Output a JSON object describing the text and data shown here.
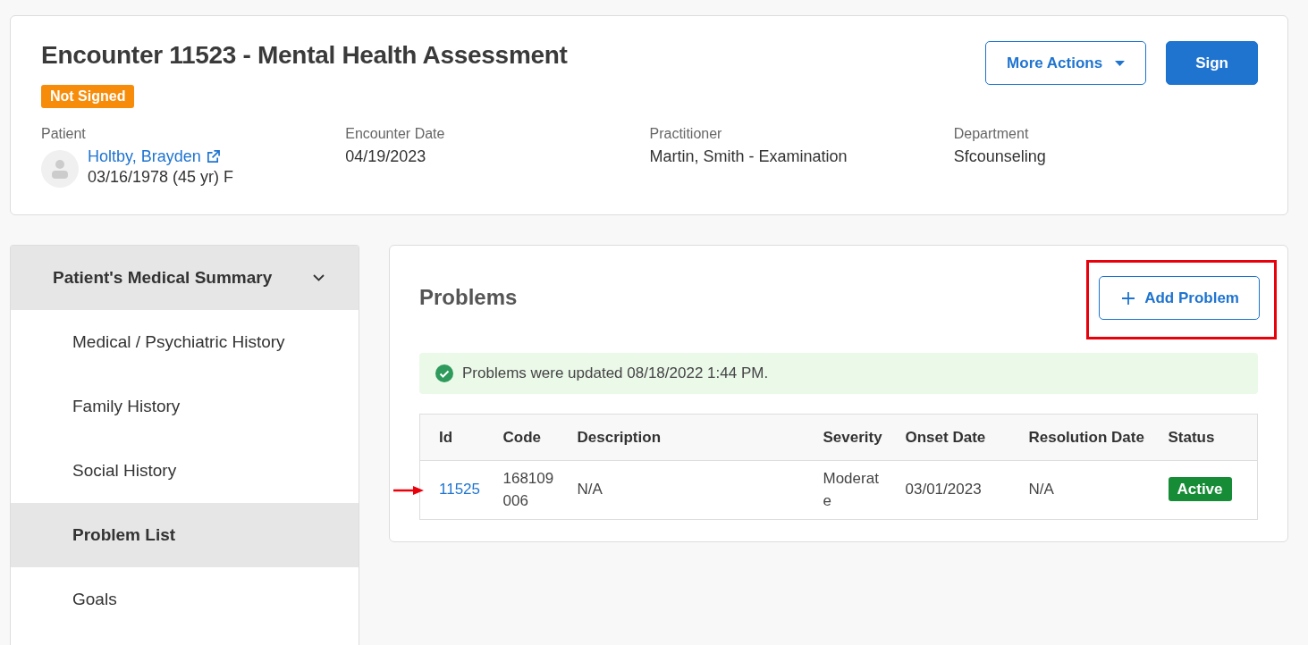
{
  "encounter": {
    "title": "Encounter 11523 - Mental Health Assessment",
    "status_badge": "Not Signed",
    "buttons": [
      {
        "kind": "dropdown",
        "label": "More Actions"
      },
      {
        "kind": "primary",
        "label": "Sign"
      }
    ],
    "fields": [
      {
        "kind": "patient",
        "label": "Patient",
        "name": "Holtby, Brayden",
        "details": "03/16/1978 (45 yr) F"
      },
      {
        "kind": "text",
        "label": "Encounter Date",
        "value": "04/19/2023"
      },
      {
        "kind": "text",
        "label": "Practitioner",
        "value": "Martin, Smith - Examination"
      },
      {
        "kind": "text",
        "label": "Department",
        "value": "Sfcounseling"
      }
    ]
  },
  "sidebar": {
    "header": {
      "label": "Patient's Medical Summary",
      "expanded": true
    },
    "items": [
      {
        "label": "Medical / Psychiatric History",
        "selected": false
      },
      {
        "label": "Family History",
        "selected": false
      },
      {
        "label": "Social History",
        "selected": false
      },
      {
        "label": "Problem List",
        "selected": true
      },
      {
        "label": "Goals",
        "selected": false
      }
    ]
  },
  "problems": {
    "title": "Problems",
    "add_button": "Add Problem",
    "alert": "Problems were updated 08/18/2022 1:44 PM.",
    "table": {
      "columns": [
        "Id",
        "Code",
        "Description",
        "Severity",
        "Onset Date",
        "Resolution Date",
        "Status"
      ],
      "rows": [
        {
          "id": "11525",
          "code": "168109006",
          "description": "N/A",
          "severity": "Moderate",
          "onset_date": "03/01/2023",
          "resolution_date": "N/A",
          "status": "Active"
        }
      ]
    }
  }
}
